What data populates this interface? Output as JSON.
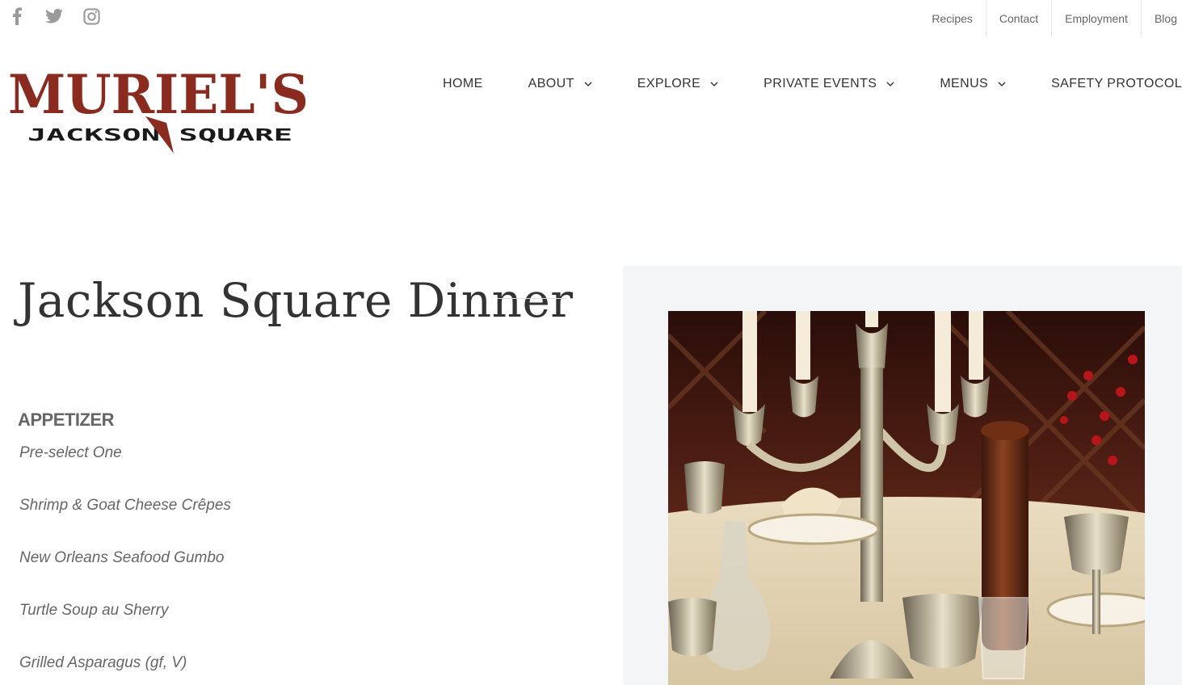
{
  "social": {
    "icons": [
      "facebook-icon",
      "twitter-icon",
      "instagram-icon"
    ],
    "color": "#9a9a9a"
  },
  "topnav": {
    "items": [
      "Recipes",
      "Contact",
      "Employment",
      "Blog"
    ]
  },
  "logo": {
    "wordmark": "MURIEL'S",
    "subtitle": "JACKSON SQUARE",
    "color": "#8b2a1e"
  },
  "mainnav": {
    "items": [
      {
        "label": "HOME",
        "dropdown": false
      },
      {
        "label": "ABOUT",
        "dropdown": true
      },
      {
        "label": "EXPLORE",
        "dropdown": true
      },
      {
        "label": "PRIVATE EVENTS",
        "dropdown": true
      },
      {
        "label": "MENUS",
        "dropdown": true
      },
      {
        "label": "SAFETY PROTOCOL",
        "dropdown": false
      }
    ]
  },
  "page": {
    "title": "Jackson Square Dinner"
  },
  "menu": {
    "heading": "APPETIZER",
    "items": [
      "Pre-select One",
      "Shrimp & Goat Cheese Crêpes",
      "New Orleans Seafood Gumbo",
      "Turtle Soup au Sherry",
      "Grilled Asparagus (gf, V)"
    ]
  },
  "photo": {
    "subject": "candelabra-table-setting-photo"
  }
}
